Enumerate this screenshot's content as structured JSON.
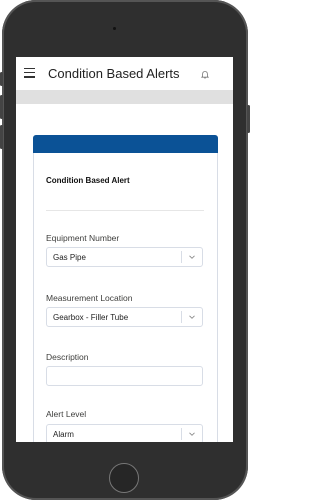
{
  "header": {
    "title": "Condition Based Alerts"
  },
  "card": {
    "title": "Condition Based Alert",
    "header_color": "#0b5296"
  },
  "fields": {
    "equipment_number": {
      "label": "Equipment Number",
      "value": "Gas Pipe"
    },
    "measurement_location": {
      "label": "Measurement Location",
      "value": "Gearbox - Filler Tube"
    },
    "description": {
      "label": "Description",
      "value": ""
    },
    "alert_level": {
      "label": "Alert Level",
      "value": "Alarm"
    }
  },
  "icons": {
    "menu": "hamburger-menu-icon",
    "notifications": "bell-icon",
    "dropdown": "chevron-down-icon"
  }
}
